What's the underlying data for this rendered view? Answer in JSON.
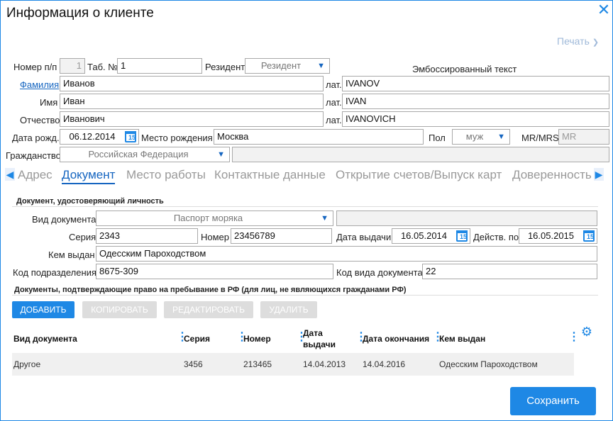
{
  "dialog": {
    "title": "Информация о клиенте",
    "print_label": "Печать"
  },
  "client": {
    "num_label": "Номер п/п",
    "num_value": "1",
    "tab_label": "Таб. №",
    "tab_value": "1",
    "resident_label": "Резидент",
    "resident_value": "Резидент",
    "emboss_label": "Эмбоссированный текст",
    "surname_label": "Фамилия",
    "surname_value": "Иванов",
    "name_label": "Имя",
    "name_value": "Иван",
    "patronymic_label": "Отчество",
    "patronymic_value": "Иванович",
    "lat_label": "лат.",
    "surname_lat": "IVANOV",
    "name_lat": "IVAN",
    "patronymic_lat": "IVANOVICH",
    "birthdate_label": "Дата рожд.",
    "birthdate_value": "06.12.2014",
    "birthplace_label": "Место рождения",
    "birthplace_value": "Москва",
    "gender_label": "Пол",
    "gender_value": "муж",
    "mrmrs_label": "MR/MRS",
    "mrmrs_value": "MR",
    "citizenship_label": "Гражданство",
    "citizenship_value": "Российская Федерация",
    "citizenship_extra": ""
  },
  "tabs": [
    "Адрес",
    "Документ",
    "Место работы",
    "Контактные данные",
    "Открытие счетов/Выпуск карт",
    "Доверенность"
  ],
  "document": {
    "section_title": "Документ, удостоверяющий личность",
    "type_label": "Вид документа",
    "type_value": "Паспорт моряка",
    "type_extra": "",
    "series_label": "Серия",
    "series_value": "2343",
    "number_label": "Номер",
    "number_value": "23456789",
    "issue_date_label": "Дата выдачи",
    "issue_date_value": "16.05.2014",
    "valid_label": "Действ. по",
    "valid_value": "16.05.2015",
    "issued_by_label": "Кем выдан",
    "issued_by_value": "Одесским Пароходством",
    "dept_code_label": "Код подразделения",
    "dept_code_value": "8675-309",
    "doc_type_code_label": "Код вида документа",
    "doc_type_code_value": "22"
  },
  "residence": {
    "section_title": "Документы, подтверждающие право на пребывание в РФ (для лиц, не являющихся гражданами РФ)",
    "buttons": {
      "add": "Добавить",
      "copy": "Копировать",
      "edit": "Редактировать",
      "delete": "Удалить"
    },
    "columns": [
      "Вид документа",
      "Серия",
      "Номер",
      "Дата выдачи",
      "Дата окончания",
      "Кем выдан"
    ],
    "rows": [
      [
        "Другое",
        "3456",
        "213465",
        "14.04.2013",
        "14.04.2016",
        "Одесским Пароходством"
      ]
    ]
  },
  "footer": {
    "save_label": "Сохранить"
  },
  "colors": {
    "accent": "#1e88e5",
    "link": "#1565c0",
    "disabled": "#dddddd"
  }
}
